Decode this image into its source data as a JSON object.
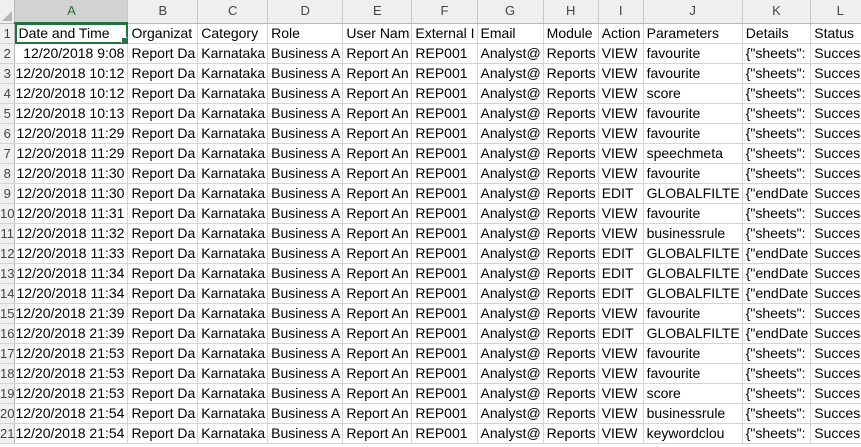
{
  "columns": [
    "A",
    "B",
    "C",
    "D",
    "E",
    "F",
    "G",
    "H",
    "I",
    "J",
    "K",
    "L"
  ],
  "rows": [
    {
      "num": "1",
      "cells": [
        "Date and Time",
        "Organizat",
        "Category",
        "Role",
        "User Nam",
        "External I",
        "Email",
        "Module",
        "Action",
        "Parameters",
        "Details",
        "Status"
      ]
    },
    {
      "num": "2",
      "cells": [
        "12/20/2018 9:08",
        "Report Da",
        "Karnataka",
        "Business A",
        "Report An",
        "REP001",
        "Analyst@",
        "Reports",
        "VIEW",
        "favourite",
        "{\"sheets\":",
        "Success"
      ]
    },
    {
      "num": "3",
      "cells": [
        "12/20/2018 10:12",
        "Report Da",
        "Karnataka",
        "Business A",
        "Report An",
        "REP001",
        "Analyst@",
        "Reports",
        "VIEW",
        "favourite",
        "{\"sheets\":",
        "Success"
      ]
    },
    {
      "num": "4",
      "cells": [
        "12/20/2018 10:12",
        "Report Da",
        "Karnataka",
        "Business A",
        "Report An",
        "REP001",
        "Analyst@",
        "Reports",
        "VIEW",
        "score",
        "{\"sheets\":",
        "Success"
      ]
    },
    {
      "num": "5",
      "cells": [
        "12/20/2018 10:13",
        "Report Da",
        "Karnataka",
        "Business A",
        "Report An",
        "REP001",
        "Analyst@",
        "Reports",
        "VIEW",
        "favourite",
        "{\"sheets\":",
        "Success"
      ]
    },
    {
      "num": "6",
      "cells": [
        "12/20/2018 11:29",
        "Report Da",
        "Karnataka",
        "Business A",
        "Report An",
        "REP001",
        "Analyst@",
        "Reports",
        "VIEW",
        "favourite",
        "{\"sheets\":",
        "Success"
      ]
    },
    {
      "num": "7",
      "cells": [
        "12/20/2018 11:29",
        "Report Da",
        "Karnataka",
        "Business A",
        "Report An",
        "REP001",
        "Analyst@",
        "Reports",
        "VIEW",
        "speechmeta",
        "{\"sheets\":",
        "Success"
      ]
    },
    {
      "num": "8",
      "cells": [
        "12/20/2018 11:30",
        "Report Da",
        "Karnataka",
        "Business A",
        "Report An",
        "REP001",
        "Analyst@",
        "Reports",
        "VIEW",
        "favourite",
        "{\"sheets\":",
        "Success"
      ]
    },
    {
      "num": "9",
      "cells": [
        "12/20/2018 11:30",
        "Report Da",
        "Karnataka",
        "Business A",
        "Report An",
        "REP001",
        "Analyst@",
        "Reports",
        "EDIT",
        "GLOBALFILTE",
        "{\"endDate",
        "Success"
      ]
    },
    {
      "num": "10",
      "cells": [
        "12/20/2018 11:31",
        "Report Da",
        "Karnataka",
        "Business A",
        "Report An",
        "REP001",
        "Analyst@",
        "Reports",
        "VIEW",
        "favourite",
        "{\"sheets\":",
        "Success"
      ]
    },
    {
      "num": "11",
      "cells": [
        "12/20/2018 11:32",
        "Report Da",
        "Karnataka",
        "Business A",
        "Report An",
        "REP001",
        "Analyst@",
        "Reports",
        "VIEW",
        "businessrule",
        "{\"sheets\":",
        "Success"
      ]
    },
    {
      "num": "12",
      "cells": [
        "12/20/2018 11:33",
        "Report Da",
        "Karnataka",
        "Business A",
        "Report An",
        "REP001",
        "Analyst@",
        "Reports",
        "EDIT",
        "GLOBALFILTE",
        "{\"endDate",
        "Success"
      ]
    },
    {
      "num": "13",
      "cells": [
        "12/20/2018 11:34",
        "Report Da",
        "Karnataka",
        "Business A",
        "Report An",
        "REP001",
        "Analyst@",
        "Reports",
        "EDIT",
        "GLOBALFILTE",
        "{\"endDate",
        "Success"
      ]
    },
    {
      "num": "14",
      "cells": [
        "12/20/2018 11:34",
        "Report Da",
        "Karnataka",
        "Business A",
        "Report An",
        "REP001",
        "Analyst@",
        "Reports",
        "EDIT",
        "GLOBALFILTE",
        "{\"endDate",
        "Success"
      ]
    },
    {
      "num": "15",
      "cells": [
        "12/20/2018 21:39",
        "Report Da",
        "Karnataka",
        "Business A",
        "Report An",
        "REP001",
        "Analyst@",
        "Reports",
        "VIEW",
        "favourite",
        "{\"sheets\":",
        "Success"
      ]
    },
    {
      "num": "16",
      "cells": [
        "12/20/2018 21:39",
        "Report Da",
        "Karnataka",
        "Business A",
        "Report An",
        "REP001",
        "Analyst@",
        "Reports",
        "EDIT",
        "GLOBALFILTE",
        "{\"endDate",
        "Success"
      ]
    },
    {
      "num": "17",
      "cells": [
        "12/20/2018 21:53",
        "Report Da",
        "Karnataka",
        "Business A",
        "Report An",
        "REP001",
        "Analyst@",
        "Reports",
        "VIEW",
        "favourite",
        "{\"sheets\":",
        "Success"
      ]
    },
    {
      "num": "18",
      "cells": [
        "12/20/2018 21:53",
        "Report Da",
        "Karnataka",
        "Business A",
        "Report An",
        "REP001",
        "Analyst@",
        "Reports",
        "VIEW",
        "favourite",
        "{\"sheets\":",
        "Success"
      ]
    },
    {
      "num": "19",
      "cells": [
        "12/20/2018 21:53",
        "Report Da",
        "Karnataka",
        "Business A",
        "Report An",
        "REP001",
        "Analyst@",
        "Reports",
        "VIEW",
        "score",
        "{\"sheets\":",
        "Success"
      ]
    },
    {
      "num": "20",
      "cells": [
        "12/20/2018 21:54",
        "Report Da",
        "Karnataka",
        "Business A",
        "Report An",
        "REP001",
        "Analyst@",
        "Reports",
        "VIEW",
        "businessrule",
        "{\"sheets\":",
        "Success"
      ]
    },
    {
      "num": "21",
      "cells": [
        "12/20/2018 21:54",
        "Report Da",
        "Karnataka",
        "Business A",
        "Report An",
        "REP001",
        "Analyst@",
        "Reports",
        "VIEW",
        "keywordclou",
        "{\"sheets\":",
        "Success"
      ]
    }
  ],
  "selection": {
    "column": "A",
    "row": "1"
  },
  "colors": {
    "accent": "#217346",
    "header_bg": "#efefef",
    "grid": "#d4d4d4"
  }
}
